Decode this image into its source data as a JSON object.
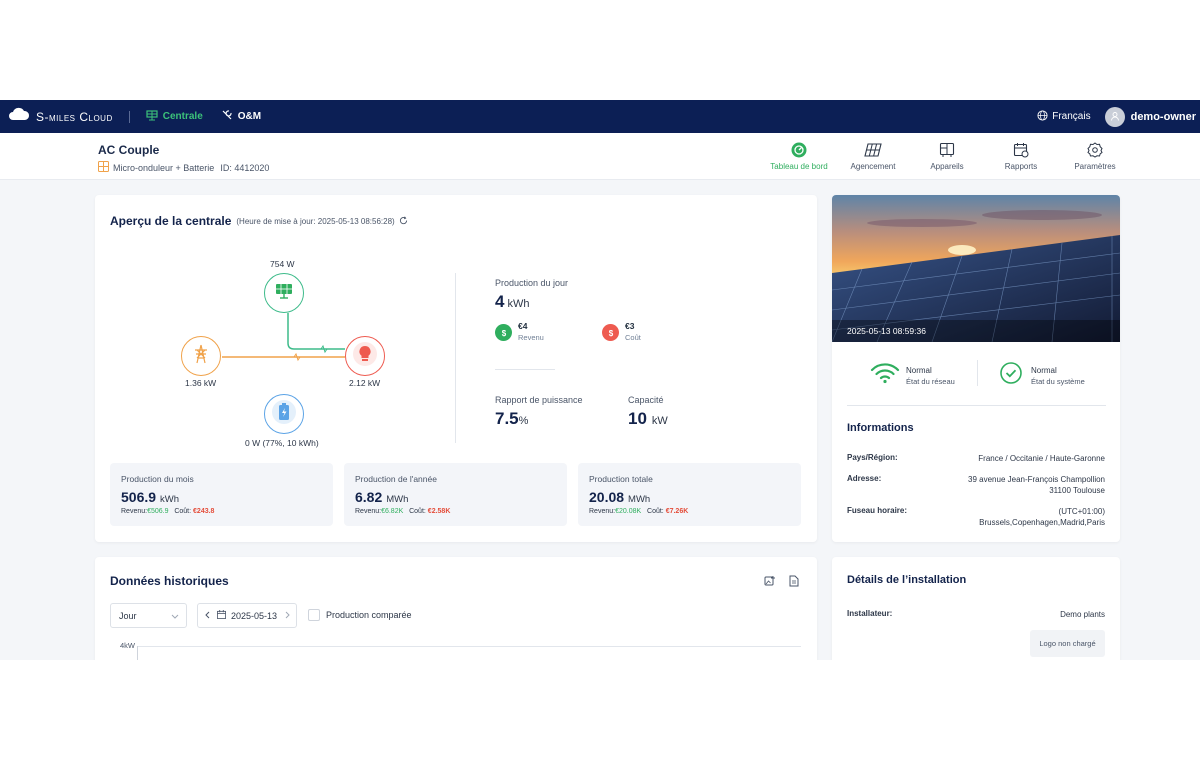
{
  "topbar": {
    "brand": "S-miles Cloud",
    "nav": [
      {
        "label": "Centrale"
      },
      {
        "label": "O&M"
      }
    ],
    "language": "Français",
    "user": "demo-owner"
  },
  "header": {
    "plant_name": "AC Couple",
    "plant_type": "Micro-onduleur + Batterie",
    "plant_id": "ID: 4412020",
    "tabs": [
      {
        "label": "Tableau de bord",
        "icon": "dashboard-icon"
      },
      {
        "label": "Agencement",
        "icon": "solar-panel-icon"
      },
      {
        "label": "Appareils",
        "icon": "devices-icon"
      },
      {
        "label": "Rapports",
        "icon": "calendar-report-icon"
      },
      {
        "label": "Paramètres",
        "icon": "gear-icon"
      }
    ]
  },
  "overview": {
    "title": "Aperçu de la centrale",
    "update_note": "(Heure de mise à jour: 2025-05-13 08:56:28)",
    "flow": {
      "solar": "754 W",
      "grid": "1.36 kW",
      "load": "2.12 kW",
      "battery": "0 W (77%, 10 kWh)"
    },
    "daily": {
      "label": "Production du jour",
      "value": "4",
      "unit": "kWh",
      "revenue_value": "€4",
      "revenue_label": "Revenu",
      "cost_value": "€3",
      "cost_label": "Coût"
    },
    "power_ratio": {
      "label": "Rapport de puissance",
      "value": "7.5",
      "unit": "%"
    },
    "capacity": {
      "label": "Capacité",
      "value": "10",
      "unit": "kW"
    },
    "summaries": [
      {
        "title": "Production du mois",
        "value": "506.9",
        "unit": "kWh",
        "revenue_label": "Revenu:",
        "revenue": "€506.9",
        "cost_label": "Coût:",
        "cost": "€243.8"
      },
      {
        "title": "Production de l'année",
        "value": "6.82",
        "unit": "MWh",
        "revenue_label": "Revenu:",
        "revenue": "€6.82K",
        "cost_label": "Coût:",
        "cost": "€2.58K"
      },
      {
        "title": "Production totale",
        "value": "20.08",
        "unit": "MWh",
        "revenue_label": "Revenu:",
        "revenue": "€20.08K",
        "cost_label": "Coût:",
        "cost": "€7.26K"
      }
    ]
  },
  "site": {
    "photo_time": "2025-05-13 08:59:36",
    "network": {
      "value": "Normal",
      "label": "État du réseau"
    },
    "system": {
      "value": "Normal",
      "label": "État du système"
    },
    "info_title": "Informations",
    "country_label": "Pays/Région:",
    "country": "France / Occitanie / Haute-Garonne",
    "address_label": "Adresse:",
    "address_1": "39 avenue Jean-François Champollion",
    "address_2": "31100 Toulouse",
    "tz_label": "Fuseau horaire:",
    "tz_1": "(UTC+01:00)",
    "tz_2": "Brussels,Copenhagen,Madrid,Paris"
  },
  "history": {
    "title": "Données historiques",
    "period": "Jour",
    "date": "2025-05-13",
    "compare_label": "Production comparée",
    "y_top": "4kW"
  },
  "install": {
    "title": "Détails de l’installation",
    "installer_label": "Installateur:",
    "installer": "Demo plants",
    "logo_text": "Logo non chargé"
  }
}
